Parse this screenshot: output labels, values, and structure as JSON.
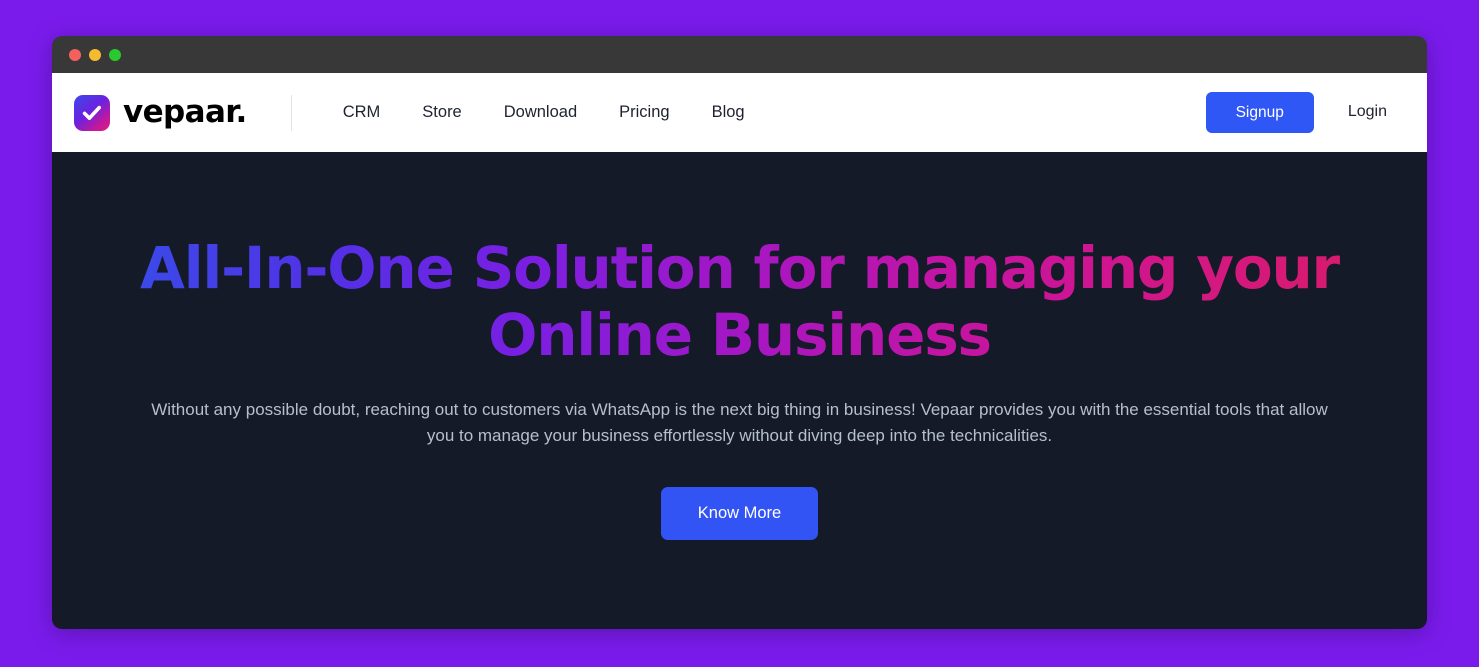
{
  "window": {
    "traffic_lights": [
      {
        "name": "close",
        "color": "#f4615c"
      },
      {
        "name": "minimize",
        "color": "#f5bb2f"
      },
      {
        "name": "maximize",
        "color": "#2ac930"
      }
    ]
  },
  "header": {
    "brand": {
      "wordmark": "vepaar.",
      "logo_icon": "check-mark-logo-icon"
    },
    "nav": [
      {
        "label": "CRM"
      },
      {
        "label": "Store"
      },
      {
        "label": "Download"
      },
      {
        "label": "Pricing"
      },
      {
        "label": "Blog"
      }
    ],
    "signup_label": "Signup",
    "login_label": "Login"
  },
  "hero": {
    "title_line_1": "All-In-One Solution for managing your",
    "title_line_2": "Online Business",
    "subtitle": "Without any possible doubt, reaching out to customers via WhatsApp is the next big thing in business! Vepaar provides you with the essential tools that allow you to manage your business effortlessly without diving deep into the technicalities.",
    "cta_label": "Know More"
  },
  "colors": {
    "page_background": "#7a1bec",
    "title_bar": "#383838",
    "header_background": "#ffffff",
    "hero_background": "#141a28",
    "signup_button": "#2f57f5",
    "cta_button": "#3354f4",
    "title_gradient_start": "#3b49e8",
    "title_gradient_end": "#d81b6e",
    "subtitle_text": "#b6bfce"
  }
}
